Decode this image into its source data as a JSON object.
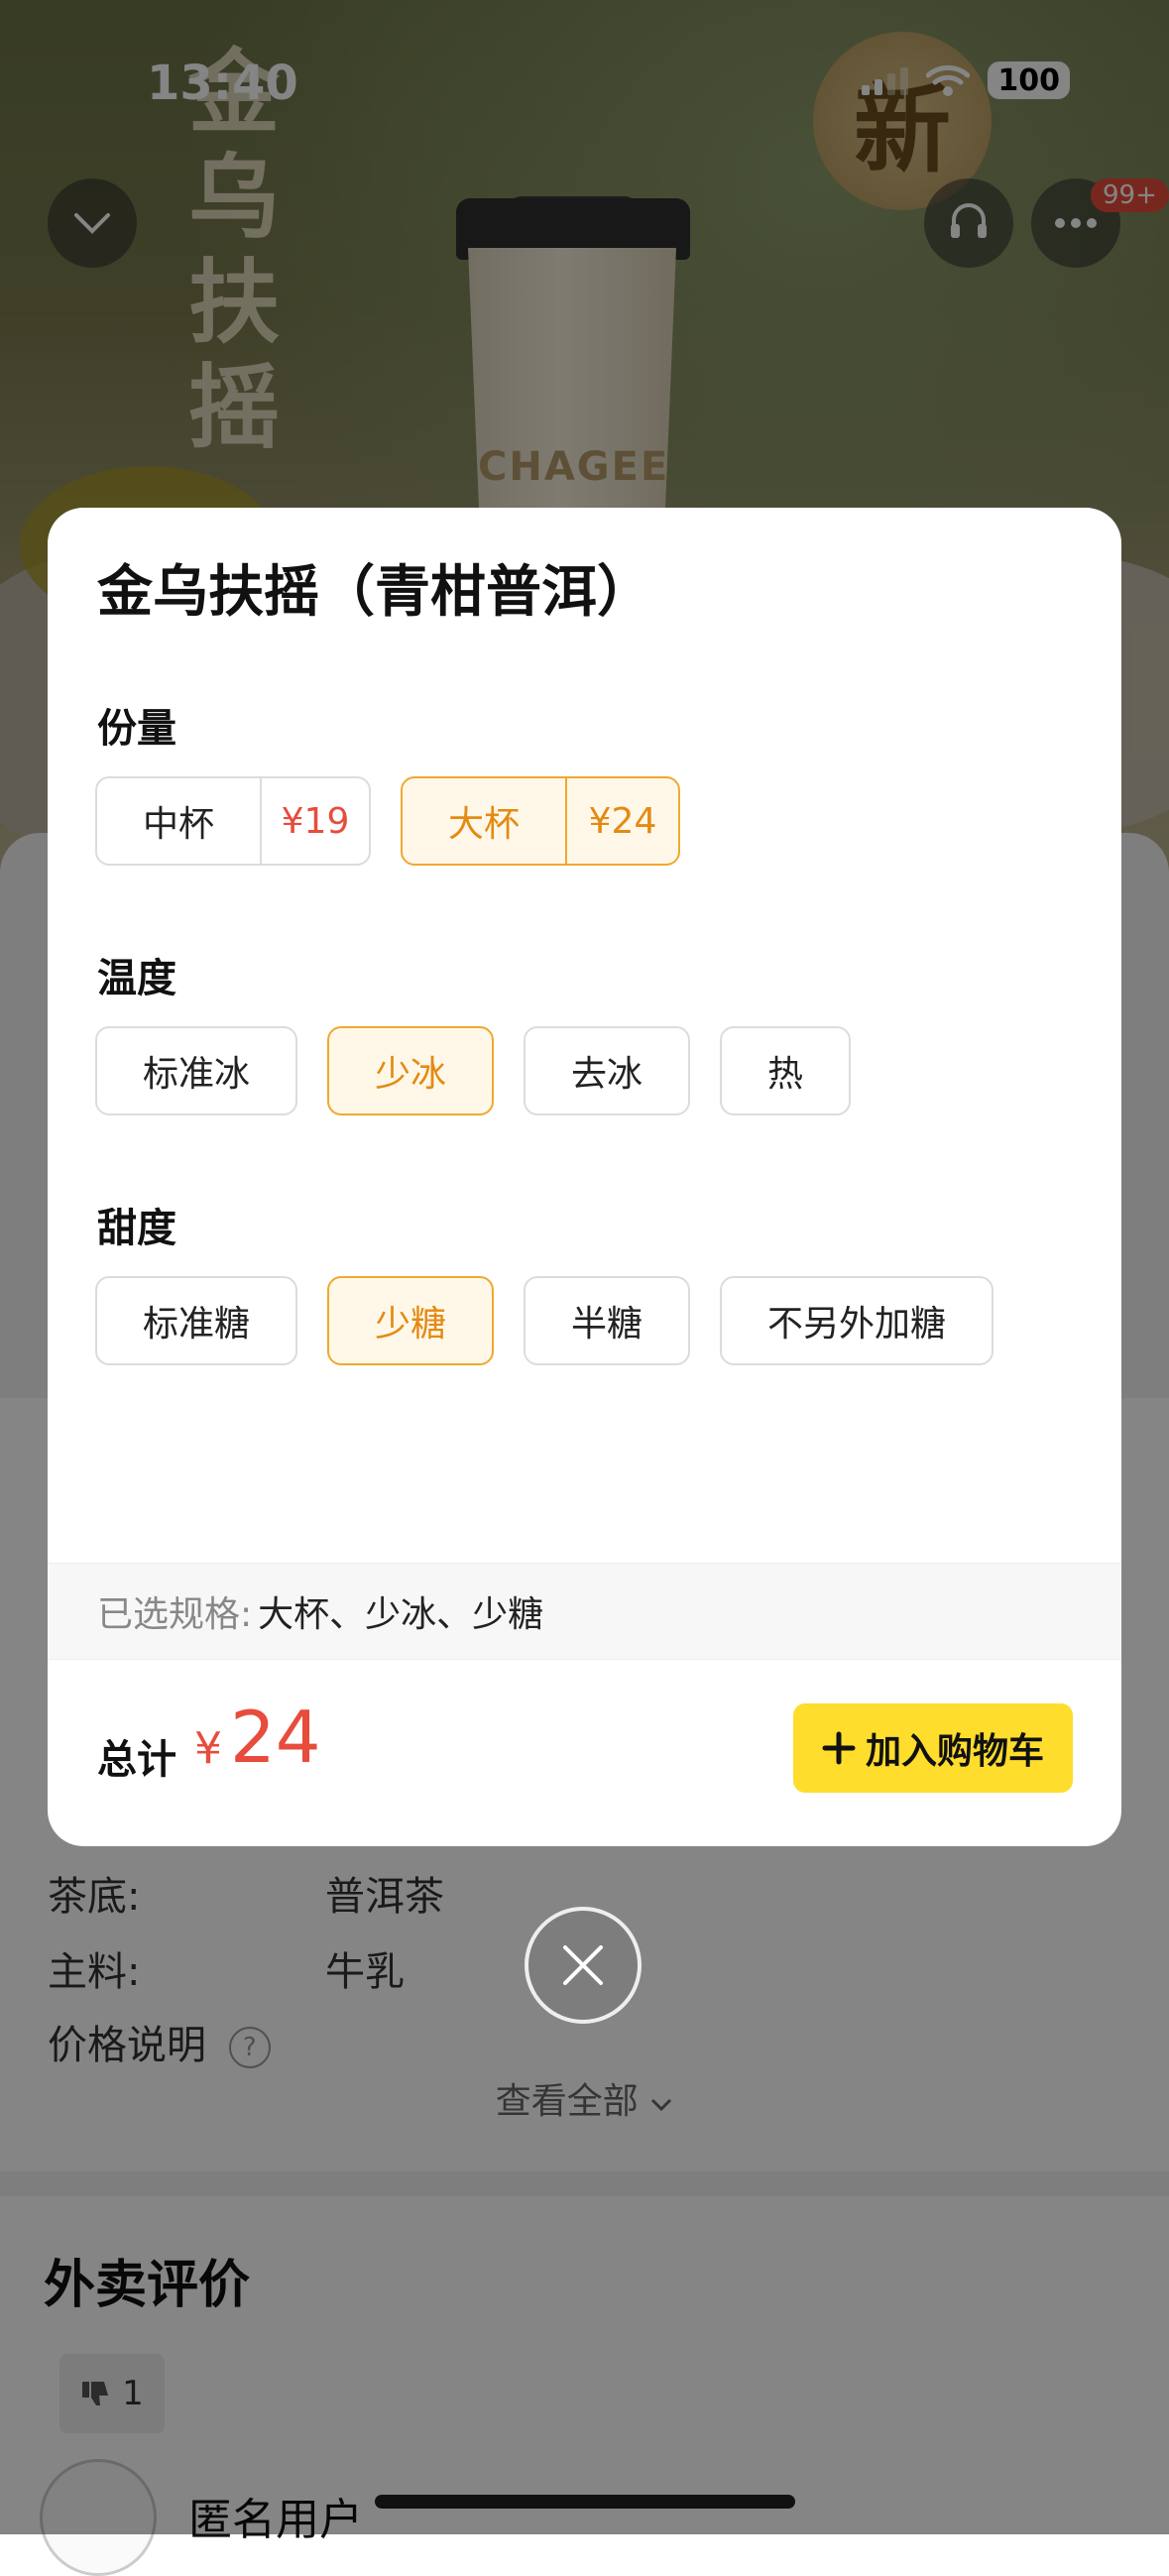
{
  "status_bar": {
    "time": "13:40",
    "battery": "100"
  },
  "hero": {
    "title": "金乌扶摇",
    "cup_brand": "CHAGEE",
    "new_badge": "新",
    "badge_count": "99+"
  },
  "background": {
    "info_rows": [
      {
        "label": "茶底:",
        "value": "普洱茶"
      },
      {
        "label": "主料:",
        "value": "牛乳"
      },
      {
        "label": "价格说明",
        "value": ""
      }
    ],
    "view_all": "查看全部",
    "review_title": "外卖评价",
    "dislike_count": "1",
    "reviewer": "匿名用户"
  },
  "modal": {
    "title": "金乌扶摇（青柑普洱）",
    "size_label": "份量",
    "sizes": [
      {
        "name": "中杯",
        "price": "¥19"
      },
      {
        "name": "大杯",
        "price": "¥24"
      }
    ],
    "temp_label": "温度",
    "temps": [
      "标准冰",
      "少冰",
      "去冰",
      "热"
    ],
    "sweet_label": "甜度",
    "sweets": [
      "标准糖",
      "少糖",
      "半糖",
      "不另外加糖"
    ],
    "selected_label": "已选规格:",
    "selected_value": "大杯、少冰、少糖",
    "total_label": "总计",
    "currency": "¥",
    "total_value": "24",
    "add_button": "加入购物车"
  },
  "colors": {
    "accent": "#f0a830",
    "price": "#e74c3c",
    "cta": "#fedd2d"
  }
}
